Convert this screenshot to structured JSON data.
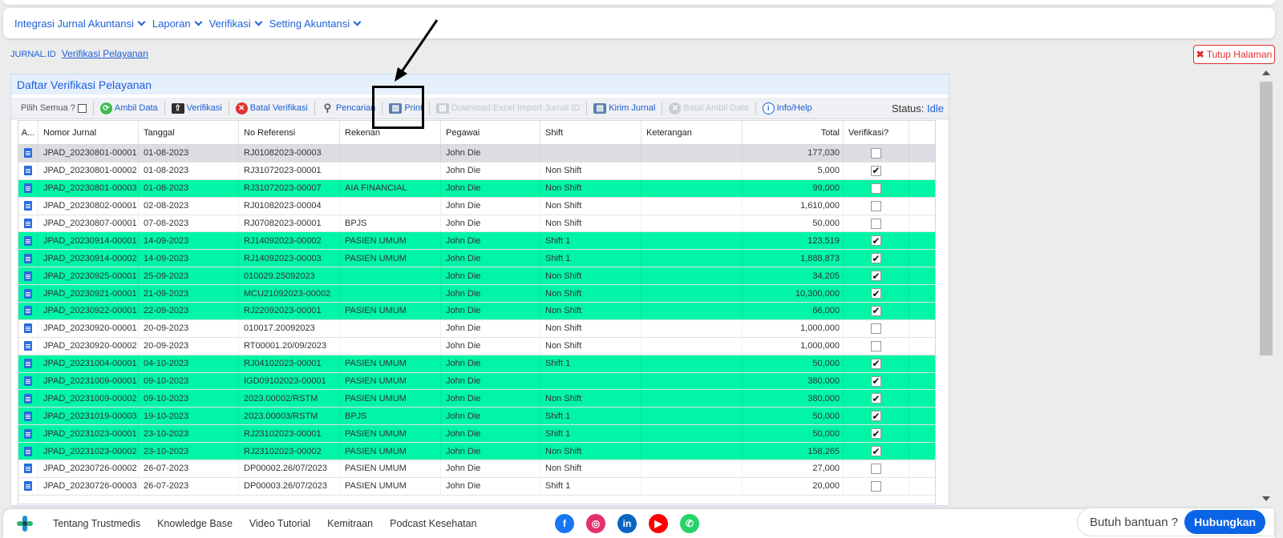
{
  "menu": [
    "Integrasi Jurnal Akuntansi",
    "Laporan",
    "Verifikasi",
    "Setting Akuntansi"
  ],
  "breadcrumb": {
    "root": "JURNAL.ID",
    "current": "Verifikasi Pelayanan"
  },
  "close_page": {
    "label": "Tutup Halaman"
  },
  "panel": {
    "title": "Daftar Verifikasi Pelayanan"
  },
  "toolbar": {
    "select_all": "Pilih Semua ?",
    "ambil_data": "Ambil Data",
    "verifikasi": "Verifikasi",
    "batal_verifikasi": "Batal Verifikasi",
    "pencarian": "Pencarian",
    "print": "Print",
    "download_excel": "Download Excel Import Jurnal ID",
    "kirim_jurnal": "Kirim Jurnal",
    "batal_ambil_data": "Batal Ambil Data",
    "info_help": "Info/Help",
    "status_label": "Status:",
    "status_value": "Idle"
  },
  "table": {
    "columns": [
      "A...",
      "Nomor Jurnal",
      "Tanggal",
      "No Referensi",
      "Rekenan",
      "Pegawai",
      "Shift",
      "Keterangan",
      "Total",
      "Verifikasi?"
    ],
    "rows": [
      {
        "nomor": "JPAD_20230801-00001",
        "tanggal": "01-08-2023",
        "ref": "RJ01082023-00003",
        "rekenan": "",
        "pegawai": "John Die",
        "shift": "",
        "ket": "",
        "total": "177,030",
        "verif": false,
        "style": "sel"
      },
      {
        "nomor": "JPAD_20230801-00002",
        "tanggal": "01-08-2023",
        "ref": "RJ31072023-00001",
        "rekenan": "",
        "pegawai": "John Die",
        "shift": "Non Shift",
        "ket": "",
        "total": "5,000",
        "verif": true,
        "style": ""
      },
      {
        "nomor": "JPAD_20230801-00003",
        "tanggal": "01-08-2023",
        "ref": "RJ31072023-00007",
        "rekenan": "AIA FINANCIAL",
        "pegawai": "John Die",
        "shift": "Non Shift",
        "ket": "",
        "total": "99,000",
        "verif": false,
        "style": "green"
      },
      {
        "nomor": "JPAD_20230802-00001",
        "tanggal": "02-08-2023",
        "ref": "RJ01082023-00004",
        "rekenan": "",
        "pegawai": "John Die",
        "shift": "Non Shift",
        "ket": "",
        "total": "1,610,000",
        "verif": false,
        "style": ""
      },
      {
        "nomor": "JPAD_20230807-00001",
        "tanggal": "07-08-2023",
        "ref": "RJ07082023-00001",
        "rekenan": "BPJS",
        "pegawai": "John Die",
        "shift": "Non Shift",
        "ket": "",
        "total": "50,000",
        "verif": false,
        "style": ""
      },
      {
        "nomor": "JPAD_20230914-00001",
        "tanggal": "14-09-2023",
        "ref": "RJ14092023-00002",
        "rekenan": "PASIEN UMUM",
        "pegawai": "John Die",
        "shift": "Shift 1",
        "ket": "",
        "total": "123,519",
        "verif": true,
        "style": "green"
      },
      {
        "nomor": "JPAD_20230914-00002",
        "tanggal": "14-09-2023",
        "ref": "RJ14092023-00003",
        "rekenan": "PASIEN UMUM",
        "pegawai": "John Die",
        "shift": "Shift 1",
        "ket": "",
        "total": "1,888,873",
        "verif": true,
        "style": "green"
      },
      {
        "nomor": "JPAD_20230925-00001",
        "tanggal": "25-09-2023",
        "ref": "010029.25092023",
        "rekenan": "",
        "pegawai": "John Die",
        "shift": "Non Shift",
        "ket": "",
        "total": "34,205",
        "verif": true,
        "style": "green"
      },
      {
        "nomor": "JPAD_20230921-00001",
        "tanggal": "21-09-2023",
        "ref": "MCU21092023-00002",
        "rekenan": "",
        "pegawai": "John Die",
        "shift": "Non Shift",
        "ket": "",
        "total": "10,300,000",
        "verif": true,
        "style": "green"
      },
      {
        "nomor": "JPAD_20230922-00001",
        "tanggal": "22-09-2023",
        "ref": "RJ22092023-00001",
        "rekenan": "PASIEN UMUM",
        "pegawai": "John Die",
        "shift": "Non Shift",
        "ket": "",
        "total": "66,000",
        "verif": true,
        "style": "green"
      },
      {
        "nomor": "JPAD_20230920-00001",
        "tanggal": "20-09-2023",
        "ref": "010017.20092023",
        "rekenan": "",
        "pegawai": "John Die",
        "shift": "Non Shift",
        "ket": "",
        "total": "1,000,000",
        "verif": false,
        "style": ""
      },
      {
        "nomor": "JPAD_20230920-00002",
        "tanggal": "20-09-2023",
        "ref": "RT00001.20/09/2023",
        "rekenan": "",
        "pegawai": "John Die",
        "shift": "Non Shift",
        "ket": "",
        "total": "1,000,000",
        "verif": false,
        "style": ""
      },
      {
        "nomor": "JPAD_20231004-00001",
        "tanggal": "04-10-2023",
        "ref": "RJ04102023-00001",
        "rekenan": "PASIEN UMUM",
        "pegawai": "John Die",
        "shift": "Shift 1",
        "ket": "",
        "total": "50,000",
        "verif": true,
        "style": "green"
      },
      {
        "nomor": "JPAD_20231009-00001",
        "tanggal": "09-10-2023",
        "ref": "IGD09102023-00001",
        "rekenan": "PASIEN UMUM",
        "pegawai": "John Die",
        "shift": "",
        "ket": "",
        "total": "380,000",
        "verif": true,
        "style": "green"
      },
      {
        "nomor": "JPAD_20231009-00002",
        "tanggal": "09-10-2023",
        "ref": "2023.00002/RSTM",
        "rekenan": "PASIEN UMUM",
        "pegawai": "John Die",
        "shift": "Non Shift",
        "ket": "",
        "total": "380,000",
        "verif": true,
        "style": "green"
      },
      {
        "nomor": "JPAD_20231019-00003",
        "tanggal": "19-10-2023",
        "ref": "2023.00003/RSTM",
        "rekenan": "BPJS",
        "pegawai": "John Die",
        "shift": "Shift 1",
        "ket": "",
        "total": "50,000",
        "verif": true,
        "style": "green"
      },
      {
        "nomor": "JPAD_20231023-00001",
        "tanggal": "23-10-2023",
        "ref": "RJ23102023-00001",
        "rekenan": "PASIEN UMUM",
        "pegawai": "John Die",
        "shift": "Shift 1",
        "ket": "",
        "total": "50,000",
        "verif": true,
        "style": "green"
      },
      {
        "nomor": "JPAD_20231023-00002",
        "tanggal": "23-10-2023",
        "ref": "RJ23102023-00002",
        "rekenan": "PASIEN UMUM",
        "pegawai": "John Die",
        "shift": "Non Shift",
        "ket": "",
        "total": "158,265",
        "verif": true,
        "style": "green"
      },
      {
        "nomor": "JPAD_20230726-00002",
        "tanggal": "26-07-2023",
        "ref": "DP00002.26/07/2023",
        "rekenan": "PASIEN UMUM",
        "pegawai": "John Die",
        "shift": "Non Shift",
        "ket": "",
        "total": "27,000",
        "verif": false,
        "style": ""
      },
      {
        "nomor": "JPAD_20230726-00003",
        "tanggal": "26-07-2023",
        "ref": "DP00003.26/07/2023",
        "rekenan": "PASIEN UMUM",
        "pegawai": "John Die",
        "shift": "Shift 1",
        "ket": "",
        "total": "20,000",
        "verif": false,
        "style": ""
      }
    ]
  },
  "footer": {
    "links": [
      "Tentang Trustmedis",
      "Knowledge Base",
      "Video Tutorial",
      "Kemitraan",
      "Podcast Kesehatan"
    ],
    "socials": [
      {
        "name": "facebook-icon",
        "color": "#1877f2",
        "glyph": "f"
      },
      {
        "name": "instagram-icon",
        "color": "#e1306c",
        "glyph": "◎"
      },
      {
        "name": "linkedin-icon",
        "color": "#0a66c2",
        "glyph": "in"
      },
      {
        "name": "youtube-icon",
        "color": "#ff0000",
        "glyph": "▶"
      },
      {
        "name": "whatsapp-icon",
        "color": "#25d366",
        "glyph": "✆"
      }
    ],
    "help_text": "Butuh bantuan ?",
    "help_button": "Hubungkan"
  },
  "colors": {
    "accent": "#1e5fd8",
    "verified_row": "#00f5a6",
    "danger": "#e03030"
  }
}
